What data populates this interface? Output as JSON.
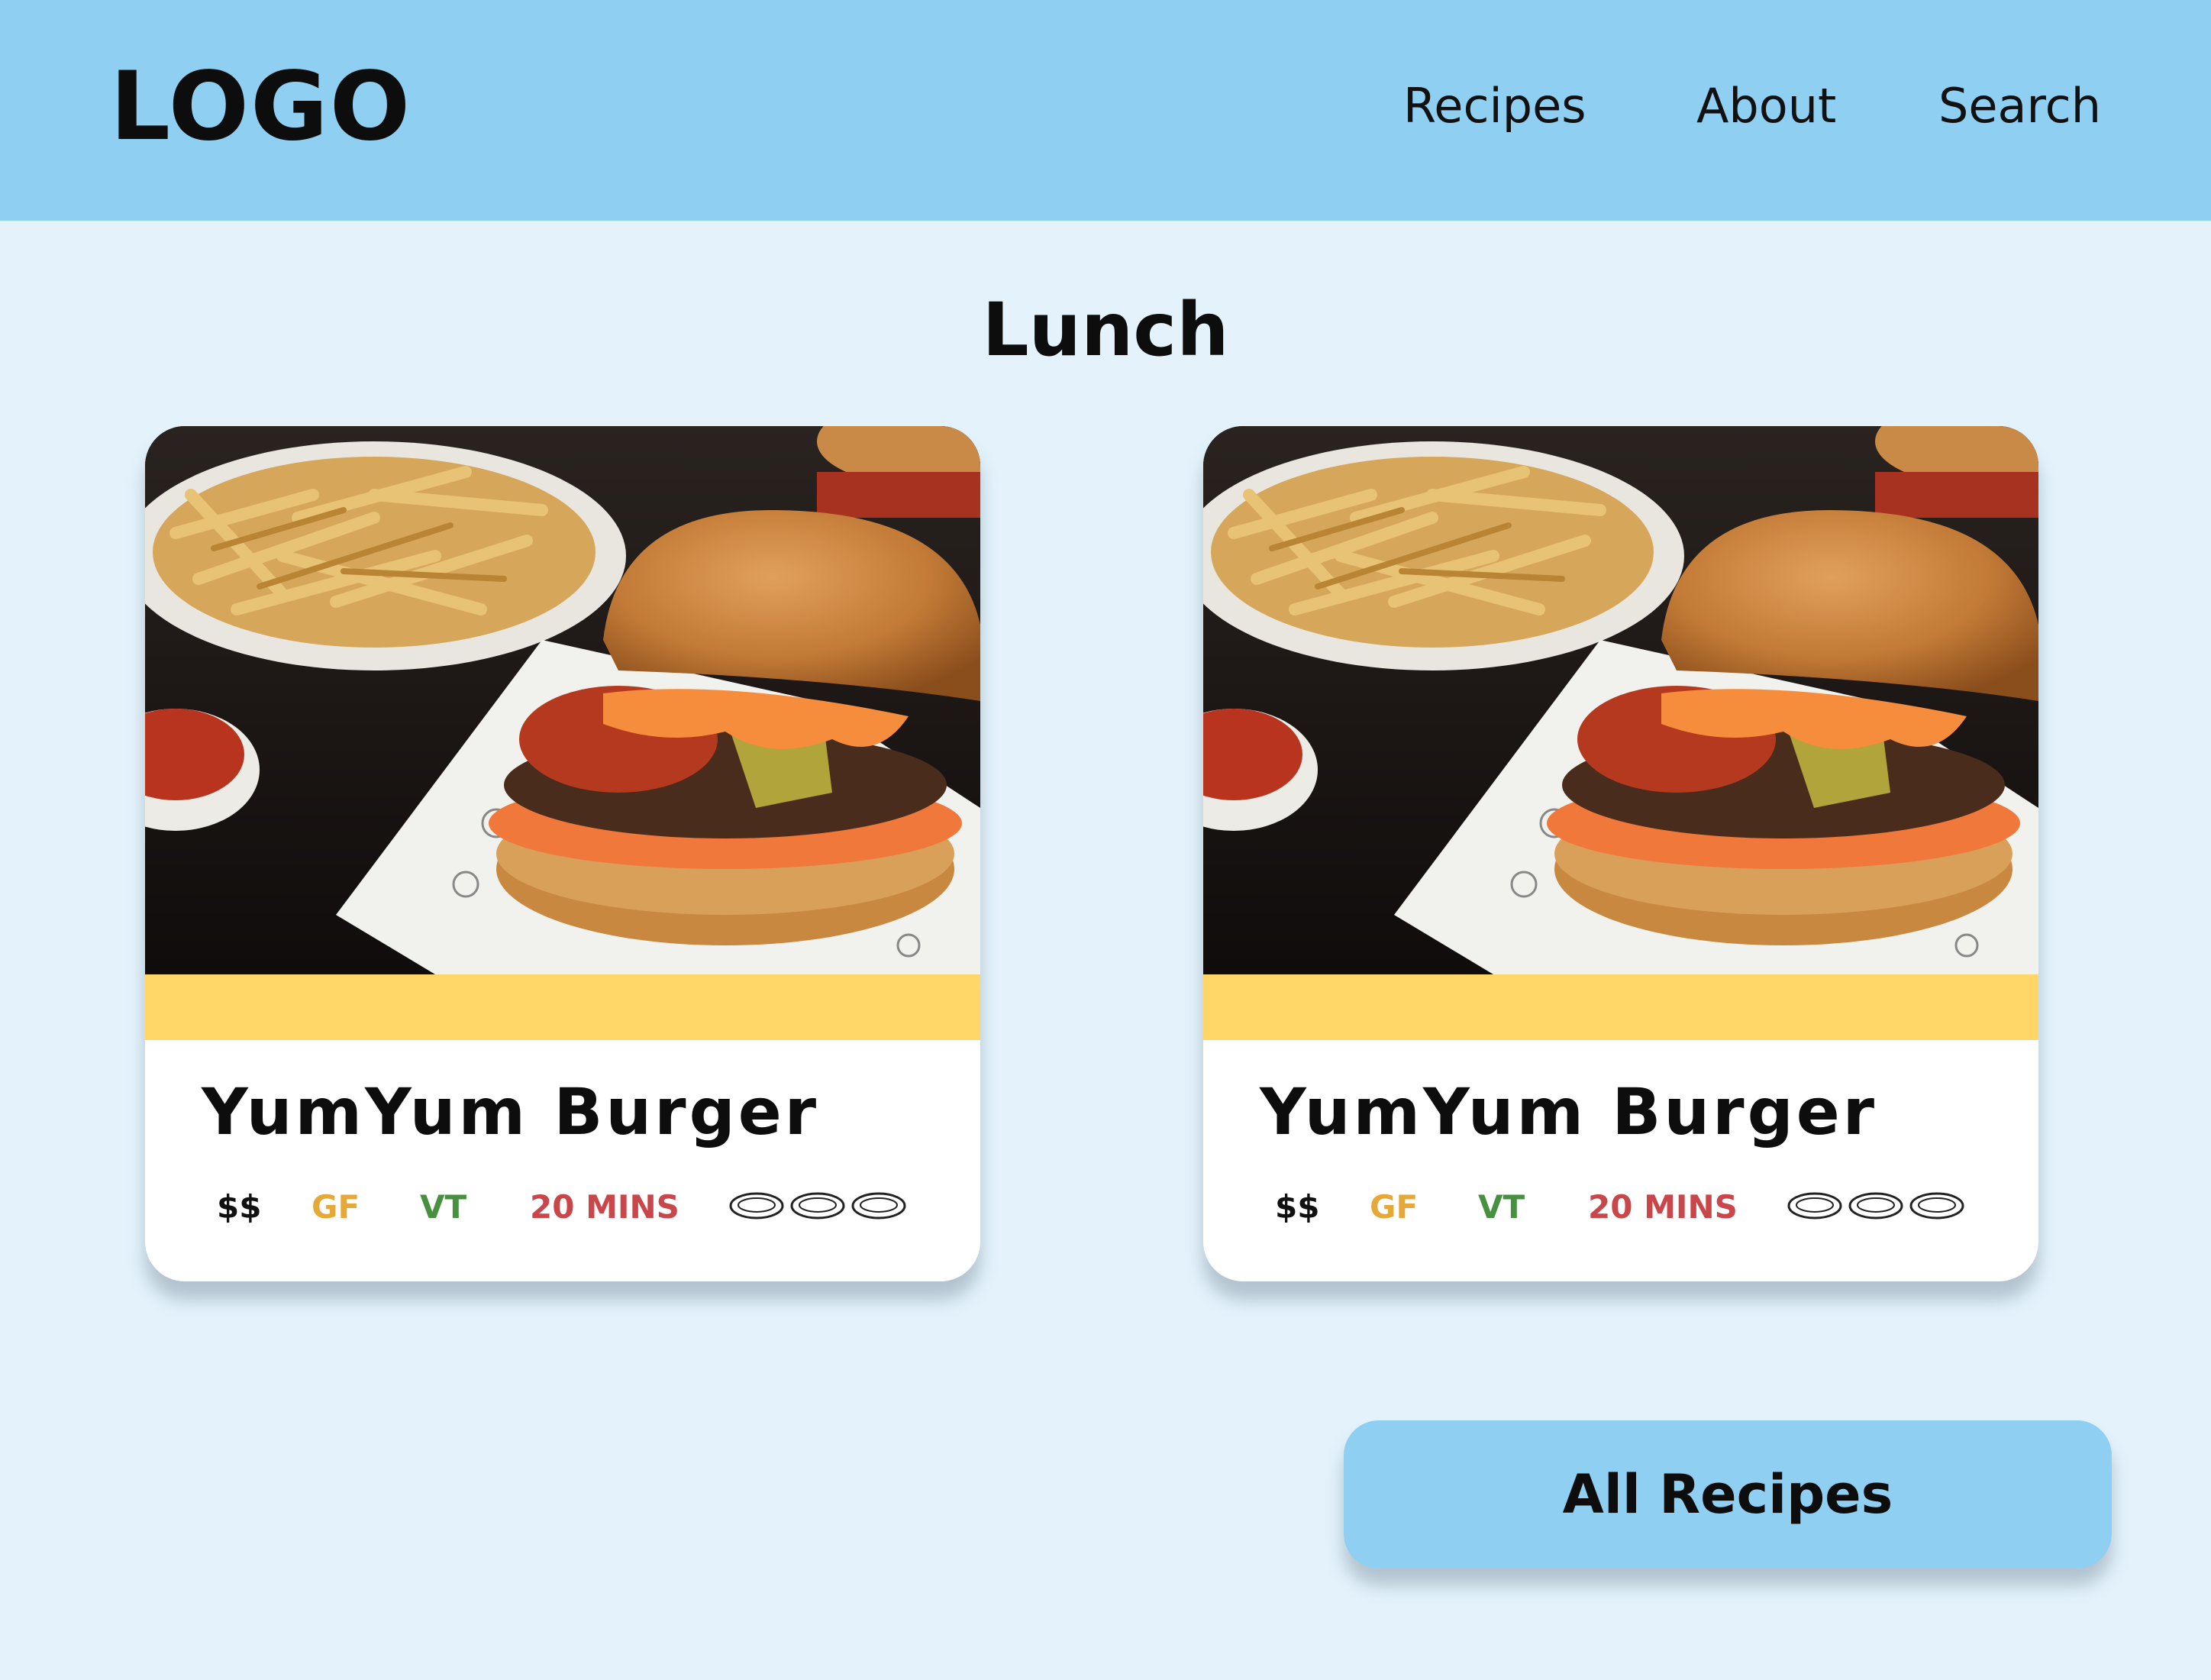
{
  "header": {
    "logo": "LOGO",
    "nav": [
      {
        "label": "Recipes"
      },
      {
        "label": "About"
      },
      {
        "label": "Search"
      }
    ]
  },
  "section": {
    "title": "Lunch"
  },
  "cards": [
    {
      "title": "YumYum Burger",
      "image": "burger-photo",
      "price": "$$",
      "tags": [
        "GF",
        "VT"
      ],
      "time": "20 MINS",
      "servings_icon": "plate-icon",
      "servings": 3
    },
    {
      "title": "YumYum Burger",
      "image": "burger-photo",
      "price": "$$",
      "tags": [
        "GF",
        "VT"
      ],
      "time": "20 MINS",
      "servings_icon": "plate-icon",
      "servings": 3
    }
  ],
  "button": {
    "label": "All Recipes"
  },
  "colors": {
    "header_bg": "#8ecff2",
    "page_bg": "#e3f2fb",
    "card_band": "#ffd667",
    "gf": "#e6a838",
    "vt": "#47903f",
    "time": "#c9474a"
  }
}
